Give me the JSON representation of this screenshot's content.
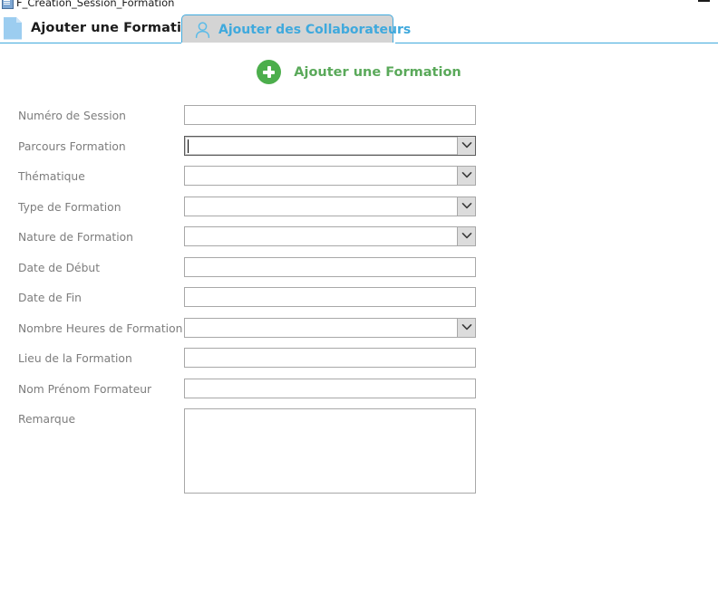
{
  "window": {
    "title": "F_Creation_Session_Formation",
    "title_icon": "form-window-icon",
    "minimize_label": "—"
  },
  "tabs": [
    {
      "label": "Ajouter une Formation",
      "icon": "document-icon",
      "active": true
    },
    {
      "label": "Ajouter des Collaborateurs",
      "icon": "person-icon",
      "active": false
    }
  ],
  "heading": {
    "icon": "plus-circle-icon",
    "text": "Ajouter une Formation"
  },
  "colors": {
    "tab_blue": "#3fa9dd",
    "heading_green": "#5aa95a",
    "plus_circle_green": "#4cae4c",
    "label_gray": "#7d7d7d",
    "field_border": "#a8a8a8",
    "inactive_tab_bg": "#d4d4d4",
    "dropdown_button_bg": "#dcdcdc",
    "doc_icon_blue": "#9ccdf0"
  },
  "form": {
    "fields": [
      {
        "label": "Numéro de Session",
        "type": "text",
        "value": "",
        "placeholder": "",
        "focused": false
      },
      {
        "label": "Parcours Formation",
        "type": "dropdown",
        "value": "",
        "placeholder": "",
        "focused": true
      },
      {
        "label": "Thématique",
        "type": "dropdown",
        "value": "",
        "placeholder": "",
        "focused": false
      },
      {
        "label": "Type de Formation",
        "type": "dropdown",
        "value": "",
        "placeholder": "",
        "focused": false
      },
      {
        "label": "Nature de Formation",
        "type": "dropdown",
        "value": "",
        "placeholder": "",
        "focused": false
      },
      {
        "label": "Date de Début",
        "type": "text",
        "value": "",
        "placeholder": "",
        "focused": false
      },
      {
        "label": "Date de Fin",
        "type": "text",
        "value": "",
        "placeholder": "",
        "focused": false
      },
      {
        "label": "Nombre Heures de Formation",
        "type": "dropdown",
        "value": "",
        "placeholder": "",
        "focused": false
      },
      {
        "label": "Lieu de la Formation",
        "type": "text",
        "value": "",
        "placeholder": "",
        "focused": false
      },
      {
        "label": "Nom Prénom Formateur",
        "type": "text",
        "value": "",
        "placeholder": "",
        "focused": false
      },
      {
        "label": "Remarque",
        "type": "textarea",
        "value": "",
        "placeholder": "",
        "focused": false
      }
    ]
  }
}
